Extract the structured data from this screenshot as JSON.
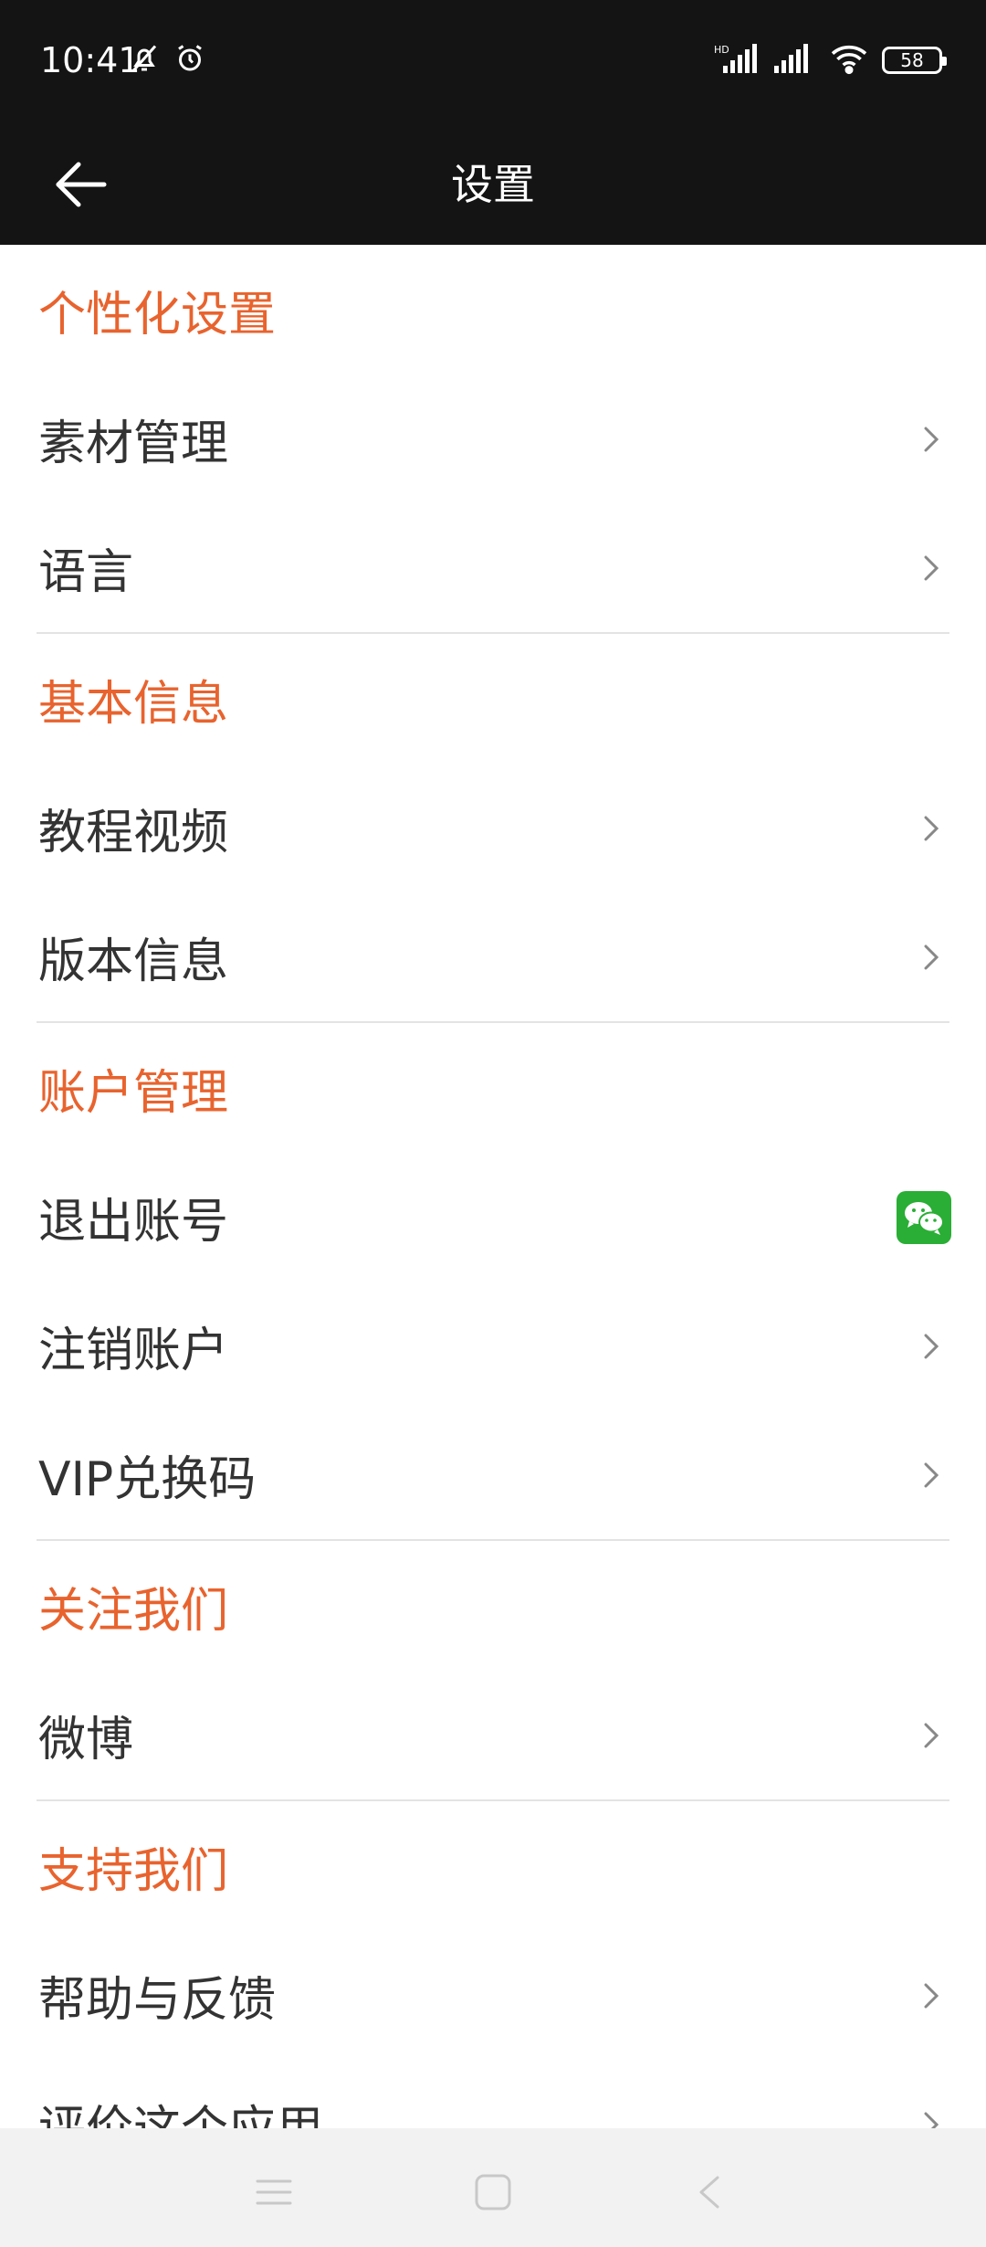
{
  "status_bar": {
    "time": "10:41",
    "battery": "58",
    "icons": [
      "bell-off-icon",
      "alarm-icon",
      "hd-signal-icon",
      "signal-icon",
      "wifi-icon",
      "battery-icon"
    ]
  },
  "header": {
    "title": "设置",
    "back_icon": "arrow-left-icon"
  },
  "sections": [
    {
      "title": "个性化设置",
      "items": [
        {
          "label": "素材管理",
          "trailing": "chevron-right-icon"
        },
        {
          "label": "语言",
          "trailing": "chevron-right-icon"
        }
      ]
    },
    {
      "title": "基本信息",
      "items": [
        {
          "label": "教程视频",
          "trailing": "chevron-right-icon"
        },
        {
          "label": "版本信息",
          "trailing": "chevron-right-icon"
        }
      ]
    },
    {
      "title": "账户管理",
      "items": [
        {
          "label": "退出账号",
          "trailing": "wechat-icon"
        },
        {
          "label": "注销账户",
          "trailing": "chevron-right-icon"
        },
        {
          "label": "VIP兑换码",
          "trailing": "chevron-right-icon"
        }
      ]
    },
    {
      "title": "关注我们",
      "items": [
        {
          "label": "微博",
          "trailing": "chevron-right-icon"
        }
      ]
    },
    {
      "title": "支持我们",
      "items": [
        {
          "label": "帮助与反馈",
          "trailing": "chevron-right-icon"
        },
        {
          "label": "评价这个应用",
          "trailing": "chevron-right-icon"
        }
      ]
    }
  ],
  "colors": {
    "accent": "#e8632e",
    "bar": "#141414",
    "wechat": "#2aae35"
  },
  "nav_bar": {
    "icons": [
      "menu-icon",
      "home-icon",
      "back-icon"
    ]
  }
}
